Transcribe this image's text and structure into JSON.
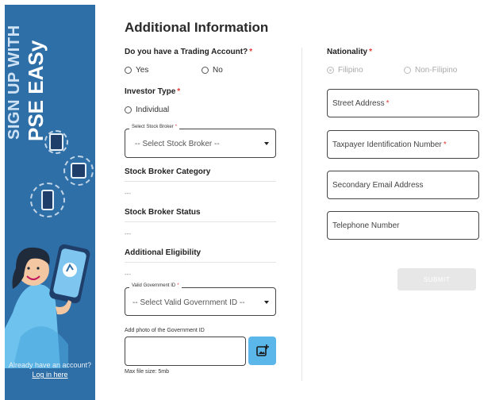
{
  "banner": {
    "title_line1": "SIGN UP WITH",
    "title_line2": "PSE EASy",
    "footer_text": "Already have an account?",
    "login_link": "Log in here",
    "colors": {
      "background": "#2f6fa8",
      "text": "#ffffff"
    }
  },
  "form": {
    "title": "Additional Information",
    "trading_account": {
      "label": "Do you have a Trading Account?",
      "required_mark": "*",
      "options": [
        "Yes",
        "No"
      ]
    },
    "investor_type": {
      "label": "Investor Type",
      "required_mark": "*",
      "options": [
        "Individual"
      ]
    },
    "stock_broker": {
      "legend": "Select Stock Broker",
      "required_mark": "*",
      "value": "-- Select Stock Broker --"
    },
    "stock_broker_category": {
      "label": "Stock Broker Category",
      "value": "---"
    },
    "stock_broker_status": {
      "label": "Stock Broker Status",
      "value": "---"
    },
    "additional_eligibility": {
      "label": "Additional Eligibility",
      "value": "---"
    },
    "government_id": {
      "legend": "Valid Government ID",
      "required_mark": "*",
      "value": "-- Select Valid Government ID --"
    },
    "photo": {
      "label": "Add photo of the Government ID",
      "hint": "Max file size: 5mb"
    },
    "nationality": {
      "label": "Nationality",
      "required_mark": "*",
      "options": [
        "Filipino",
        "Non-Filipino"
      ],
      "selected": "Filipino"
    },
    "street_address": {
      "placeholder": "Street Address",
      "required_mark": "*"
    },
    "tin": {
      "placeholder": "Taxpayer Identification Number",
      "required_mark": "*"
    },
    "secondary_email": {
      "placeholder": "Secondary Email Address"
    },
    "telephone": {
      "placeholder": "Telephone Number"
    },
    "submit_label": "SUBMIT"
  },
  "colors": {
    "accent": "#5bb6ea",
    "required": "#e53935",
    "submit_bg": "#e7e7e7"
  }
}
